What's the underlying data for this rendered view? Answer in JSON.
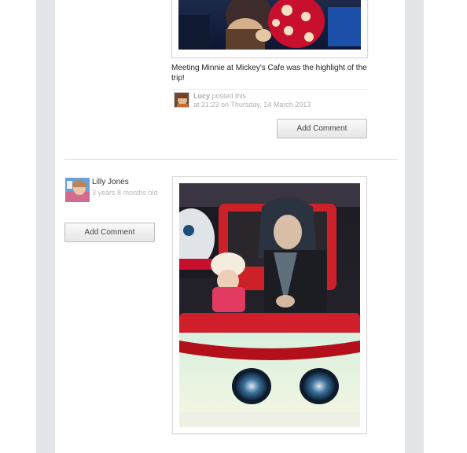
{
  "post1": {
    "caption": "Meeting Minnie at Mickey's Cafe was the highlight of the trip!",
    "poster_name": "Lucy",
    "poster_action": "posted this",
    "poster_time": "at 21:23 on Thursday, 14 March 2013",
    "add_comment_label": "Add Comment",
    "photo_icon": "photo-minnie-mouse"
  },
  "post2": {
    "user_name": "Lilly Jones",
    "user_age": "3 years 8 months old",
    "add_comment_label": "Add Comment",
    "photo_icon": "photo-fairground-car-ride"
  },
  "colors": {
    "page_gutter": "#e4e5e8",
    "button_border": "#bdbdbd",
    "muted_text": "#b0b0b0"
  }
}
